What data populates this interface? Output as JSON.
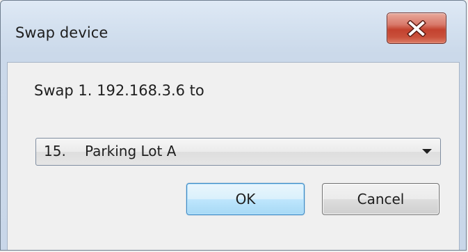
{
  "window": {
    "title": "Swap device",
    "close_icon": "close-x-icon"
  },
  "dialog": {
    "prompt": "Swap 1. 192.168.3.6 to",
    "dropdown": {
      "selected_number": "15.",
      "selected_label": "Parking Lot A",
      "arrow_icon": "chevron-down-icon"
    },
    "buttons": {
      "ok_label": "OK",
      "cancel_label": "Cancel"
    }
  },
  "colors": {
    "title_bar": "#d3e0ef",
    "close_button": "#c3422f",
    "ok_button_focus": "#3b8bc7",
    "dialog_background": "#f0f0f0"
  }
}
